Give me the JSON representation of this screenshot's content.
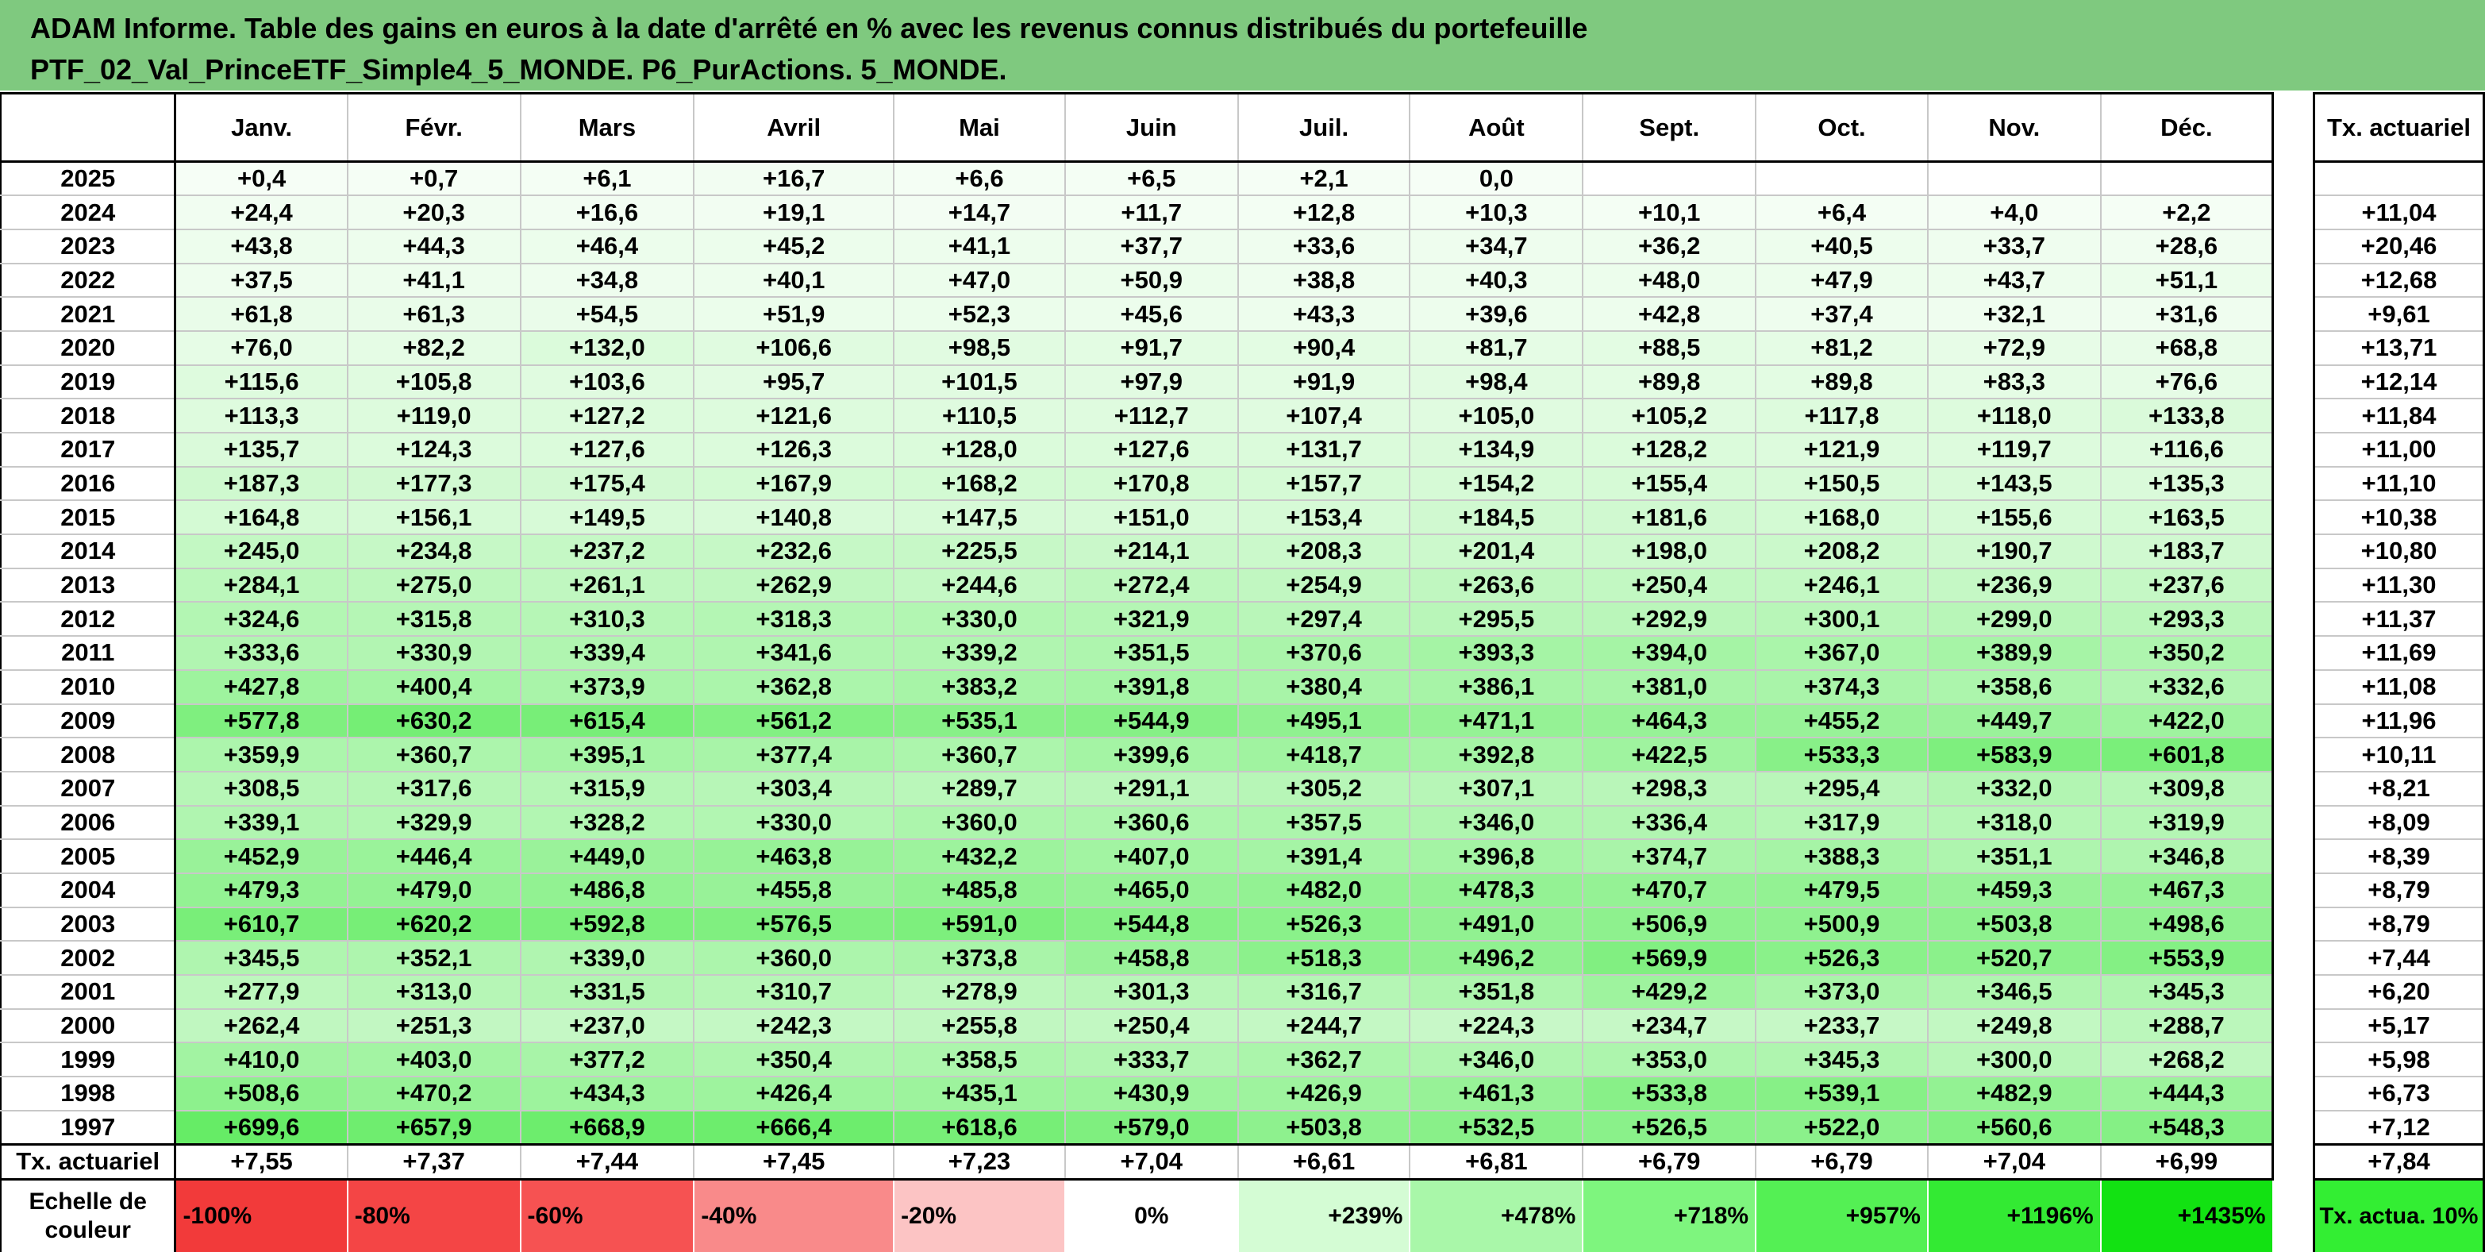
{
  "title": {
    "line1": "ADAM Informe. Table des gains en euros à la date d'arrêté en % avec les revenus connus distribués du portefeuille",
    "line2": "PTF_02_Val_PrinceETF_Simple4_5_MONDE. P6_PurActions. 5_MONDE."
  },
  "table": {
    "months": [
      "Janv.",
      "Févr.",
      "Mars",
      "Avril",
      "Mai",
      "Juin",
      "Juil.",
      "Août",
      "Sept.",
      "Oct.",
      "Nov.",
      "Déc."
    ],
    "tx_header": "Tx. actuariel",
    "rows": [
      {
        "year": "2025",
        "values": [
          "+0,4",
          "+0,7",
          "+6,1",
          "+16,7",
          "+6,6",
          "+6,5",
          "+2,1",
          "0,0",
          "",
          "",
          "",
          ""
        ],
        "tx": ""
      },
      {
        "year": "2024",
        "values": [
          "+24,4",
          "+20,3",
          "+16,6",
          "+19,1",
          "+14,7",
          "+11,7",
          "+12,8",
          "+10,3",
          "+10,1",
          "+6,4",
          "+4,0",
          "+2,2"
        ],
        "tx": "+11,04"
      },
      {
        "year": "2023",
        "values": [
          "+43,8",
          "+44,3",
          "+46,4",
          "+45,2",
          "+41,1",
          "+37,7",
          "+33,6",
          "+34,7",
          "+36,2",
          "+40,5",
          "+33,7",
          "+28,6"
        ],
        "tx": "+20,46"
      },
      {
        "year": "2022",
        "values": [
          "+37,5",
          "+41,1",
          "+34,8",
          "+40,1",
          "+47,0",
          "+50,9",
          "+38,8",
          "+40,3",
          "+48,0",
          "+47,9",
          "+43,7",
          "+51,1"
        ],
        "tx": "+12,68"
      },
      {
        "year": "2021",
        "values": [
          "+61,8",
          "+61,3",
          "+54,5",
          "+51,9",
          "+52,3",
          "+45,6",
          "+43,3",
          "+39,6",
          "+42,8",
          "+37,4",
          "+32,1",
          "+31,6"
        ],
        "tx": "+9,61"
      },
      {
        "year": "2020",
        "values": [
          "+76,0",
          "+82,2",
          "+132,0",
          "+106,6",
          "+98,5",
          "+91,7",
          "+90,4",
          "+81,7",
          "+88,5",
          "+81,2",
          "+72,9",
          "+68,8"
        ],
        "tx": "+13,71"
      },
      {
        "year": "2019",
        "values": [
          "+115,6",
          "+105,8",
          "+103,6",
          "+95,7",
          "+101,5",
          "+97,9",
          "+91,9",
          "+98,4",
          "+89,8",
          "+89,8",
          "+83,3",
          "+76,6"
        ],
        "tx": "+12,14"
      },
      {
        "year": "2018",
        "values": [
          "+113,3",
          "+119,0",
          "+127,2",
          "+121,6",
          "+110,5",
          "+112,7",
          "+107,4",
          "+105,0",
          "+105,2",
          "+117,8",
          "+118,0",
          "+133,8"
        ],
        "tx": "+11,84"
      },
      {
        "year": "2017",
        "values": [
          "+135,7",
          "+124,3",
          "+127,6",
          "+126,3",
          "+128,0",
          "+127,6",
          "+131,7",
          "+134,9",
          "+128,2",
          "+121,9",
          "+119,7",
          "+116,6"
        ],
        "tx": "+11,00"
      },
      {
        "year": "2016",
        "values": [
          "+187,3",
          "+177,3",
          "+175,4",
          "+167,9",
          "+168,2",
          "+170,8",
          "+157,7",
          "+154,2",
          "+155,4",
          "+150,5",
          "+143,5",
          "+135,3"
        ],
        "tx": "+11,10"
      },
      {
        "year": "2015",
        "values": [
          "+164,8",
          "+156,1",
          "+149,5",
          "+140,8",
          "+147,5",
          "+151,0",
          "+153,4",
          "+184,5",
          "+181,6",
          "+168,0",
          "+155,6",
          "+163,5"
        ],
        "tx": "+10,38"
      },
      {
        "year": "2014",
        "values": [
          "+245,0",
          "+234,8",
          "+237,2",
          "+232,6",
          "+225,5",
          "+214,1",
          "+208,3",
          "+201,4",
          "+198,0",
          "+208,2",
          "+190,7",
          "+183,7"
        ],
        "tx": "+10,80"
      },
      {
        "year": "2013",
        "values": [
          "+284,1",
          "+275,0",
          "+261,1",
          "+262,9",
          "+244,6",
          "+272,4",
          "+254,9",
          "+263,6",
          "+250,4",
          "+246,1",
          "+236,9",
          "+237,6"
        ],
        "tx": "+11,30"
      },
      {
        "year": "2012",
        "values": [
          "+324,6",
          "+315,8",
          "+310,3",
          "+318,3",
          "+330,0",
          "+321,9",
          "+297,4",
          "+295,5",
          "+292,9",
          "+300,1",
          "+299,0",
          "+293,3"
        ],
        "tx": "+11,37"
      },
      {
        "year": "2011",
        "values": [
          "+333,6",
          "+330,9",
          "+339,4",
          "+341,6",
          "+339,2",
          "+351,5",
          "+370,6",
          "+393,3",
          "+394,0",
          "+367,0",
          "+389,9",
          "+350,2"
        ],
        "tx": "+11,69"
      },
      {
        "year": "2010",
        "values": [
          "+427,8",
          "+400,4",
          "+373,9",
          "+362,8",
          "+383,2",
          "+391,8",
          "+380,4",
          "+386,1",
          "+381,0",
          "+374,3",
          "+358,6",
          "+332,6"
        ],
        "tx": "+11,08"
      },
      {
        "year": "2009",
        "values": [
          "+577,8",
          "+630,2",
          "+615,4",
          "+561,2",
          "+535,1",
          "+544,9",
          "+495,1",
          "+471,1",
          "+464,3",
          "+455,2",
          "+449,7",
          "+422,0"
        ],
        "tx": "+11,96"
      },
      {
        "year": "2008",
        "values": [
          "+359,9",
          "+360,7",
          "+395,1",
          "+377,4",
          "+360,7",
          "+399,6",
          "+418,7",
          "+392,8",
          "+422,5",
          "+533,3",
          "+583,9",
          "+601,8"
        ],
        "tx": "+10,11"
      },
      {
        "year": "2007",
        "values": [
          "+308,5",
          "+317,6",
          "+315,9",
          "+303,4",
          "+289,7",
          "+291,1",
          "+305,2",
          "+307,1",
          "+298,3",
          "+295,4",
          "+332,0",
          "+309,8"
        ],
        "tx": "+8,21"
      },
      {
        "year": "2006",
        "values": [
          "+339,1",
          "+329,9",
          "+328,2",
          "+330,0",
          "+360,0",
          "+360,6",
          "+357,5",
          "+346,0",
          "+336,4",
          "+317,9",
          "+318,0",
          "+319,9"
        ],
        "tx": "+8,09"
      },
      {
        "year": "2005",
        "values": [
          "+452,9",
          "+446,4",
          "+449,0",
          "+463,8",
          "+432,2",
          "+407,0",
          "+391,4",
          "+396,8",
          "+374,7",
          "+388,3",
          "+351,1",
          "+346,8"
        ],
        "tx": "+8,39"
      },
      {
        "year": "2004",
        "values": [
          "+479,3",
          "+479,0",
          "+486,8",
          "+455,8",
          "+485,8",
          "+465,0",
          "+482,0",
          "+478,3",
          "+470,7",
          "+479,5",
          "+459,3",
          "+467,3"
        ],
        "tx": "+8,79"
      },
      {
        "year": "2003",
        "values": [
          "+610,7",
          "+620,2",
          "+592,8",
          "+576,5",
          "+591,0",
          "+544,8",
          "+526,3",
          "+491,0",
          "+506,9",
          "+500,9",
          "+503,8",
          "+498,6"
        ],
        "tx": "+8,79"
      },
      {
        "year": "2002",
        "values": [
          "+345,5",
          "+352,1",
          "+339,0",
          "+360,0",
          "+373,8",
          "+458,8",
          "+518,3",
          "+496,2",
          "+569,9",
          "+526,3",
          "+520,7",
          "+553,9"
        ],
        "tx": "+7,44"
      },
      {
        "year": "2001",
        "values": [
          "+277,9",
          "+313,0",
          "+331,5",
          "+310,7",
          "+278,9",
          "+301,3",
          "+316,7",
          "+351,8",
          "+429,2",
          "+373,0",
          "+346,5",
          "+345,3"
        ],
        "tx": "+6,20"
      },
      {
        "year": "2000",
        "values": [
          "+262,4",
          "+251,3",
          "+237,0",
          "+242,3",
          "+255,8",
          "+250,4",
          "+244,7",
          "+224,3",
          "+234,7",
          "+233,7",
          "+249,8",
          "+288,7"
        ],
        "tx": "+5,17"
      },
      {
        "year": "1999",
        "values": [
          "+410,0",
          "+403,0",
          "+377,2",
          "+350,4",
          "+358,5",
          "+333,7",
          "+362,7",
          "+346,0",
          "+353,0",
          "+345,3",
          "+300,0",
          "+268,2"
        ],
        "tx": "+5,98"
      },
      {
        "year": "1998",
        "values": [
          "+508,6",
          "+470,2",
          "+434,3",
          "+426,4",
          "+435,1",
          "+430,9",
          "+426,9",
          "+461,3",
          "+533,8",
          "+539,1",
          "+482,9",
          "+444,3"
        ],
        "tx": "+6,73"
      },
      {
        "year": "1997",
        "values": [
          "+699,6",
          "+657,9",
          "+668,9",
          "+666,4",
          "+618,6",
          "+579,0",
          "+503,8",
          "+532,5",
          "+526,5",
          "+522,0",
          "+560,6",
          "+548,3"
        ],
        "tx": "+7,12"
      }
    ],
    "footer": {
      "label": "Tx. actuariel",
      "values": [
        "+7,55",
        "+7,37",
        "+7,44",
        "+7,45",
        "+7,23",
        "+7,04",
        "+6,61",
        "+6,81",
        "+6,79",
        "+6,79",
        "+7,04",
        "+6,99"
      ],
      "tx": "+7,84"
    },
    "scale": {
      "label": "Echelle de couleur",
      "cells": [
        {
          "text": "-100%",
          "color": "#f23a3a",
          "align": "left"
        },
        {
          "text": "-80%",
          "color": "#f44545",
          "align": "left"
        },
        {
          "text": "-60%",
          "color": "#f65252",
          "align": "left"
        },
        {
          "text": "-40%",
          "color": "#f98a8a",
          "align": "left"
        },
        {
          "text": "-20%",
          "color": "#fcc4c4",
          "align": "left"
        },
        {
          "text": "0%",
          "color": "#ffffff",
          "align": "mid"
        },
        {
          "text": "+239%",
          "color": "#d4fcd4",
          "align": "right"
        },
        {
          "text": "+478%",
          "color": "#a9f7a9",
          "align": "right"
        },
        {
          "text": "+718%",
          "color": "#7ef57e",
          "align": "right"
        },
        {
          "text": "+957%",
          "color": "#54f054",
          "align": "right"
        },
        {
          "text": "+1196%",
          "color": "#33ea33",
          "align": "right"
        },
        {
          "text": "+1435%",
          "color": "#12e212",
          "align": "right"
        }
      ],
      "tx_label": "Tx. actua. 10%"
    }
  },
  "colors": {
    "title_bg": "#7fc97f",
    "scale_max": "#12e212",
    "scale_zero": "#ffffff",
    "tx_legend": "#33ee33"
  }
}
